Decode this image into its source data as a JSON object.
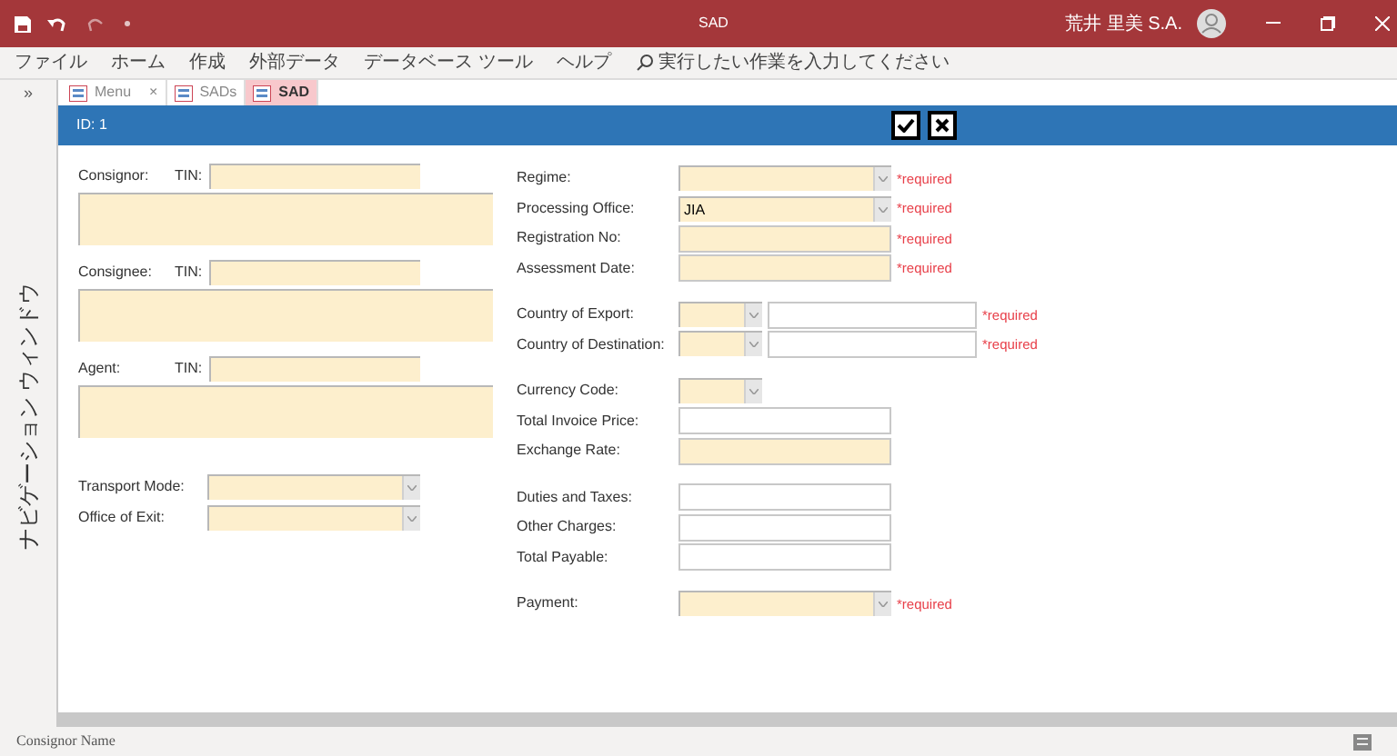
{
  "window": {
    "title": "SAD",
    "user": "荒井 里美 S.A."
  },
  "menu": [
    "ファイル",
    "ホーム",
    "作成",
    "外部データ",
    "データベース ツール",
    "ヘルプ"
  ],
  "search": {
    "placeholder": "実行したい作業を入力してください"
  },
  "nav_pane": {
    "toggle": "»",
    "title": "ナビゲーション ウィンドウ"
  },
  "tabs": [
    {
      "label": "Menu",
      "selected": false,
      "closable": true,
      "close_glyph": "×"
    },
    {
      "label": "SADs",
      "selected": false,
      "closable": false
    },
    {
      "label": "SAD",
      "selected": true,
      "closable": false
    }
  ],
  "form_header": {
    "id_label": "ID:",
    "id_value": "1"
  },
  "parties": [
    {
      "label": "Consignor:",
      "tin_label": "TIN:"
    },
    {
      "label": "Consignee:",
      "tin_label": "TIN:"
    },
    {
      "label": "Agent:",
      "tin_label": "TIN:"
    }
  ],
  "left_combos": [
    {
      "label": "Transport Mode:"
    },
    {
      "label": "Office of Exit:"
    }
  ],
  "field_groups": [
    [
      {
        "label": "Regime:",
        "kind": "combo",
        "mandatory": true,
        "note": "*required"
      },
      {
        "label": "Processing Office:",
        "kind": "combo",
        "mandatory": true,
        "value": "JIA",
        "note": "*required"
      },
      {
        "label": "Registration No:",
        "kind": "text",
        "mandatory": true,
        "note": "*required"
      },
      {
        "label": "Assessment Date:",
        "kind": "text",
        "mandatory": true,
        "note": "*required"
      }
    ],
    [
      {
        "label": "Country of Export:",
        "kind": "code",
        "mandatory": true,
        "note": "*required"
      },
      {
        "label": "Country of Destination:",
        "kind": "code",
        "mandatory": true,
        "note": "*required"
      }
    ],
    [
      {
        "label": "Currency Code:",
        "kind": "short",
        "mandatory": true
      },
      {
        "label": "Total Invoice Price:",
        "kind": "text",
        "mandatory": false
      },
      {
        "label": "Exchange Rate:",
        "kind": "text",
        "mandatory": true
      }
    ],
    [
      {
        "label": "Duties and Taxes:",
        "kind": "text",
        "mandatory": false
      },
      {
        "label": "Other Charges:",
        "kind": "text",
        "mandatory": false
      },
      {
        "label": "Total Payable:",
        "kind": "text",
        "mandatory": false
      }
    ],
    [
      {
        "label": "Payment:",
        "kind": "combo",
        "mandatory": true,
        "note": "*required"
      }
    ]
  ],
  "status_bar": {
    "text": "Consignor Name"
  }
}
